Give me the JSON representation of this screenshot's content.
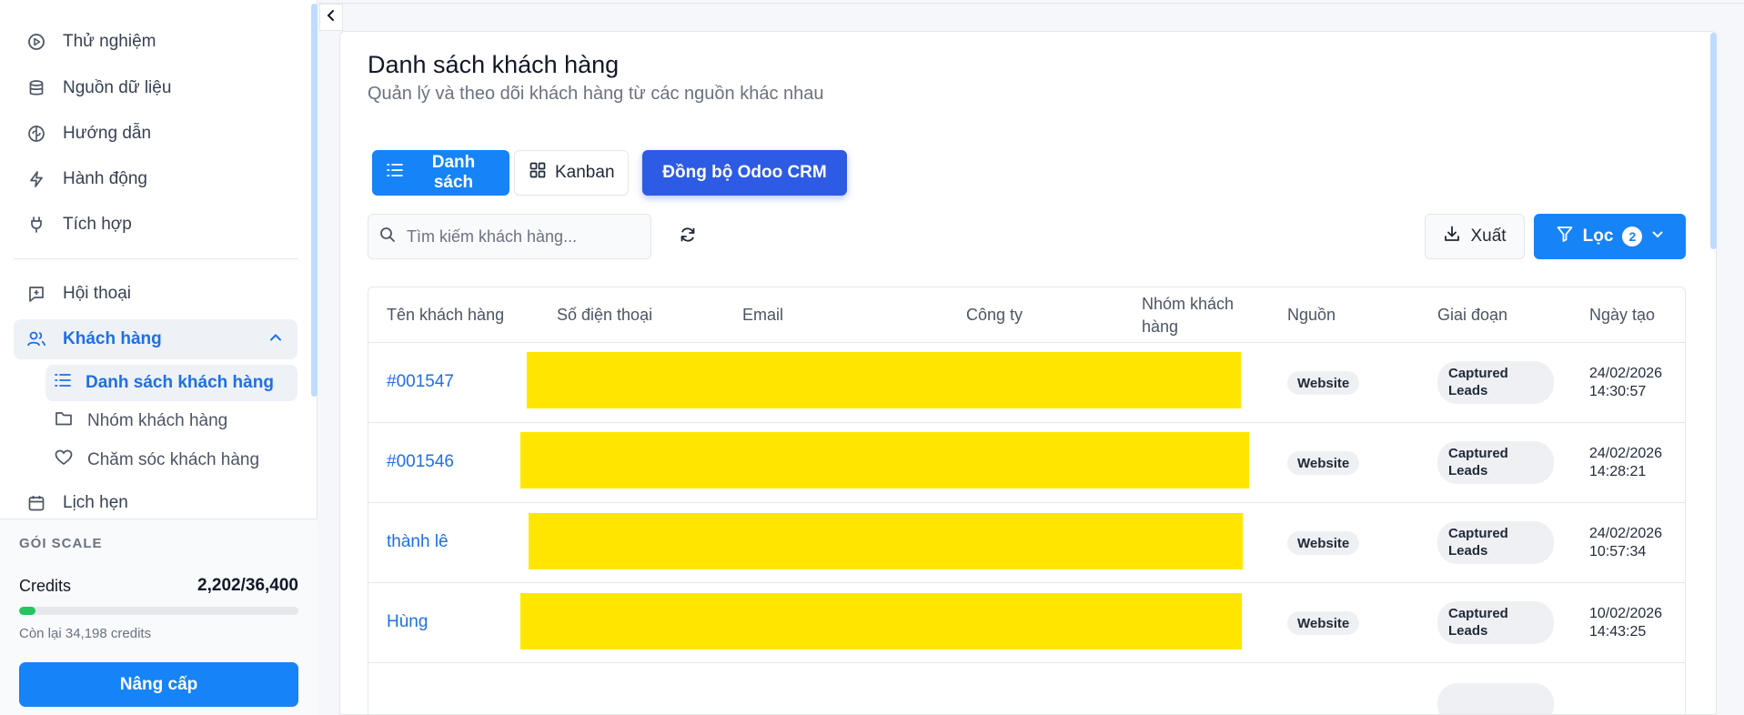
{
  "sidebar": {
    "items": [
      {
        "label": "Thử nghiệm",
        "icon": "play-circle-icon"
      },
      {
        "label": "Nguồn dữ liệu",
        "icon": "database-icon"
      },
      {
        "label": "Hướng dẫn",
        "icon": "brain-icon"
      },
      {
        "label": "Hành động",
        "icon": "lightning-icon"
      },
      {
        "label": "Tích hợp",
        "icon": "plug-icon"
      },
      {
        "label": "Hội thoại",
        "icon": "message-plus-icon"
      },
      {
        "label": "Khách hàng",
        "icon": "users-icon"
      },
      {
        "label": "Lịch hẹn",
        "icon": "calendar-icon"
      }
    ],
    "subitems": [
      {
        "label": "Danh sách khách hàng",
        "icon": "list-icon"
      },
      {
        "label": "Nhóm khách hàng",
        "icon": "folder-icon"
      },
      {
        "label": "Chăm sóc khách hàng",
        "icon": "heart-icon"
      }
    ],
    "plan": {
      "label": "GÓI SCALE",
      "credits_label": "Credits",
      "credits_value": "2,202/36,400",
      "usage_fraction": 0.06,
      "remaining": "Còn lại 34,198 credits",
      "upgrade_label": "Nâng cấp"
    }
  },
  "header": {
    "title": "Danh sách khách hàng",
    "subtitle": "Quản lý và theo dõi khách hàng từ các nguồn khác nhau"
  },
  "toolbar": {
    "list_label": "Danh sách",
    "kanban_label": "Kanban",
    "sync_label": "Đồng bộ Odoo CRM",
    "search_placeholder": "Tìm kiếm khách hàng...",
    "export_label": "Xuất",
    "filter_label": "Lọc",
    "filter_count": "2"
  },
  "table": {
    "columns": [
      "Tên khách hàng",
      "Số điện thoại",
      "Email",
      "Công ty",
      "Nhóm khách hàng",
      "Nguồn",
      "Giai đoạn",
      "Ngày tạo"
    ],
    "rows": [
      {
        "name": "#001547",
        "source": "Website",
        "stage": "Captured Leads",
        "date": "24/02/2026",
        "time": "14:30:57"
      },
      {
        "name": "#001546",
        "source": "Website",
        "stage": "Captured Leads",
        "date": "24/02/2026",
        "time": "14:28:21"
      },
      {
        "name": "thành lê",
        "source": "Website",
        "stage": "Captured Leads",
        "date": "24/02/2026",
        "time": "10:57:34"
      },
      {
        "name": "Hùng",
        "source": "Website",
        "stage": "Captured Leads",
        "date": "10/02/2026",
        "time": "14:43:25"
      }
    ]
  },
  "colors": {
    "primary": "#1683f7",
    "sync": "#2d5be3",
    "link": "#1f6fe5",
    "redaction": "#ffe600",
    "progress": "#22c55e"
  }
}
